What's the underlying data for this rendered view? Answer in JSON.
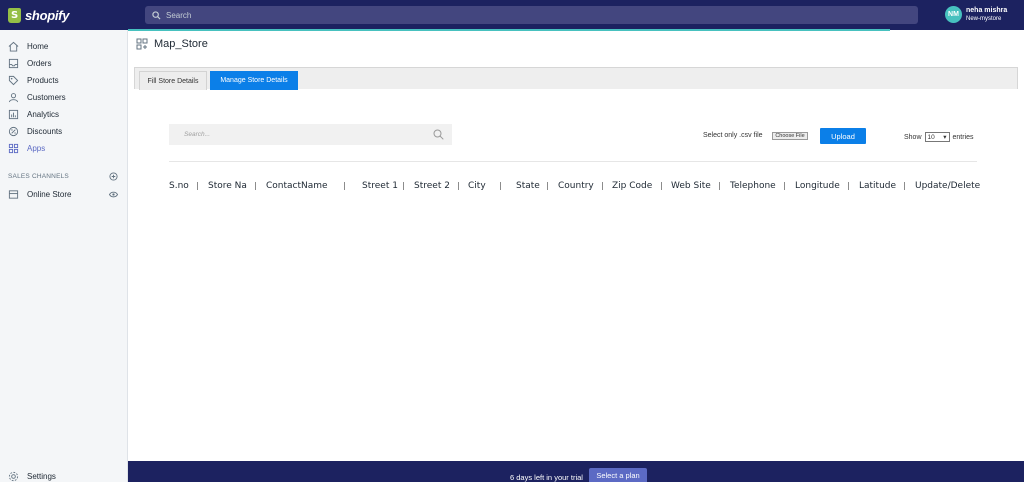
{
  "topbar": {
    "logo_text": "shopify",
    "search_placeholder": "Search",
    "user": {
      "initials": "NM",
      "name": "neha mishra",
      "store": "New-mystore"
    }
  },
  "sidebar": {
    "items": [
      {
        "label": "Home",
        "icon": "home-icon"
      },
      {
        "label": "Orders",
        "icon": "orders-icon"
      },
      {
        "label": "Products",
        "icon": "tag-icon"
      },
      {
        "label": "Customers",
        "icon": "person-icon"
      },
      {
        "label": "Analytics",
        "icon": "bar-chart-icon"
      },
      {
        "label": "Discounts",
        "icon": "discount-icon"
      },
      {
        "label": "Apps",
        "icon": "apps-icon"
      }
    ],
    "sales_channels_label": "SALES CHANNELS",
    "online_store_label": "Online Store",
    "settings_label": "Settings"
  },
  "page": {
    "title": "Map_Store"
  },
  "tabs": [
    "Fill Store Details",
    "Manage Store Details"
  ],
  "toolbar": {
    "search_placeholder": "Search...",
    "csv_label": "Select only .csv file",
    "choose_file_label": "Choose File",
    "upload_label": "Upload",
    "show_label": "Show",
    "entries_value": "10",
    "entries_label": "entries"
  },
  "table": {
    "columns": [
      "S.no",
      "Store Na",
      "ContactName",
      "Street 1",
      "Street 2",
      "City",
      "State",
      "Country",
      "Zip Code",
      "Web Site",
      "Telephone",
      "Longitude",
      "Latitude",
      "Update/Delete"
    ],
    "separator": "|"
  },
  "footer": {
    "trial_text": "6 days left in your trial",
    "plan_button": "Select a plan"
  },
  "colors": {
    "navy": "#1c2260",
    "accent": "#5c6ac4",
    "blue": "#0b7fe8",
    "teal": "#47c1bf"
  }
}
